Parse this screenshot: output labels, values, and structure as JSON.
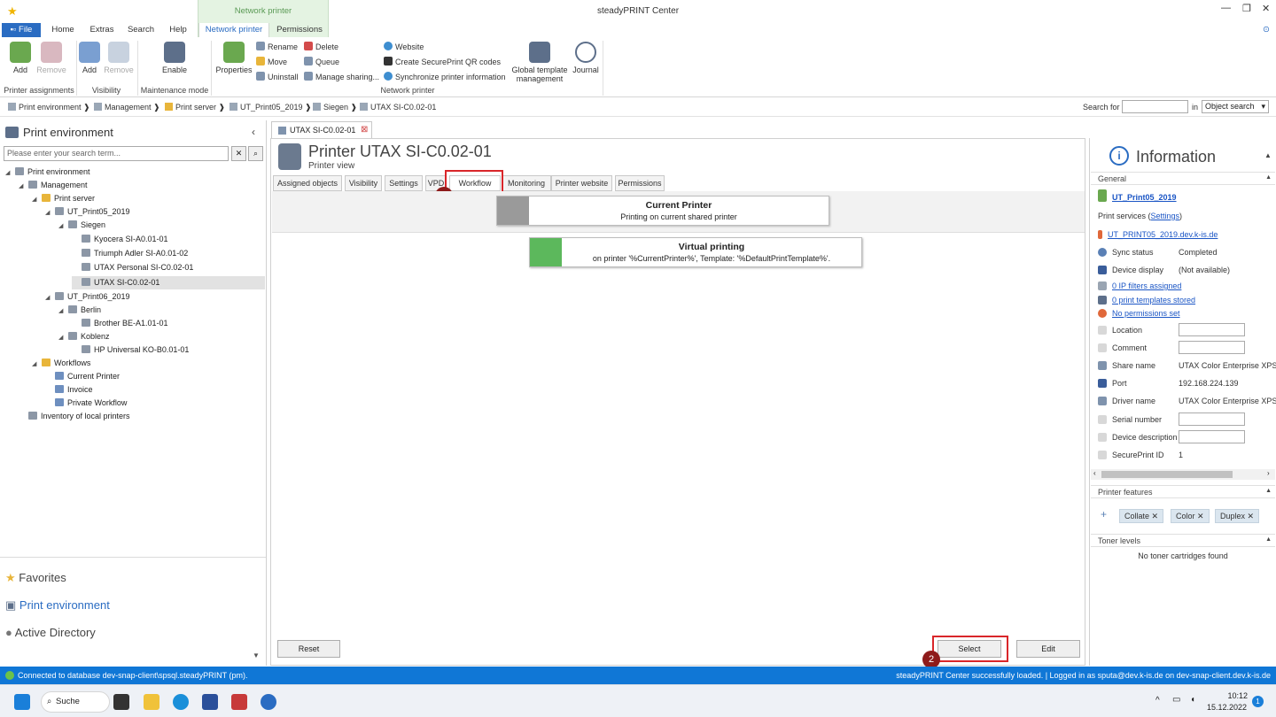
{
  "window": {
    "title": "steadyPRINT Center"
  },
  "ribbon_tabs": {
    "file": "File",
    "home": "Home",
    "extras": "Extras",
    "search": "Search",
    "help": "Help",
    "network_printer": "Network printer",
    "permissions": "Permissions",
    "context_group": "Network printer"
  },
  "ribbon": {
    "add": "Add",
    "remove": "Remove",
    "group_printer_assignments": "Printer assignments",
    "vis_add": "Add",
    "vis_remove": "Remove",
    "group_visibility": "Visibility",
    "enable": "Enable",
    "group_maintenance": "Maintenance mode",
    "properties": "Properties",
    "rename": "Rename",
    "move": "Move",
    "uninstall": "Uninstall",
    "delete": "Delete",
    "queue": "Queue",
    "manage_sharing": "Manage sharing...",
    "website": "Website",
    "qr_codes": "Create SecurePrint QR codes",
    "sync_info": "Synchronize printer information",
    "global_template_1": "Global template",
    "global_template_2": "management",
    "journal": "Journal",
    "group_network_printer": "Network printer"
  },
  "breadcrumb": {
    "items": [
      "Print environment",
      "Management",
      "Print server",
      "UT_Print05_2019",
      "Siegen",
      "UTAX SI-C0.02-01"
    ],
    "search_for": "Search for",
    "in": "in",
    "scope": "Object search"
  },
  "left": {
    "title": "Print environment",
    "search_placeholder": "Please enter your search term...",
    "tree": [
      "Print environment",
      "Management",
      "Print server",
      "UT_Print05_2019",
      "Siegen",
      "Kyocera SI-A0.01-01",
      "Triumph Adler SI-A0.01-02",
      "UTAX Personal SI-C0.02-01",
      "UTAX SI-C0.02-01",
      "UT_Print06_2019",
      "Berlin",
      "Brother BE-A1.01-01",
      "Koblenz",
      "HP Universal KO-B0.01-01",
      "Workflows",
      "Current Printer",
      "Invoice",
      "Private Workflow",
      "Inventory of local printers"
    ],
    "nav": {
      "favorites": "Favorites",
      "print_environment": "Print environment",
      "active_directory": "Active Directory"
    }
  },
  "center": {
    "doc_tab": "UTAX SI-C0.02-01",
    "title": "Printer UTAX SI-C0.02-01",
    "subtitle": "Printer view",
    "tabs": [
      "Assigned objects",
      "Visibility",
      "Settings",
      "VPD",
      "Workflow",
      "Monitoring",
      "Printer website",
      "Permissions"
    ],
    "card1_title": "Current Printer",
    "card1_sub": "Printing on current shared printer",
    "card2_title": "Virtual printing",
    "card2_sub": "on printer '%CurrentPrinter%', Template: '%DefaultPrintTemplate%'.",
    "reset": "Reset",
    "select": "Select",
    "edit": "Edit",
    "badge1": "1",
    "badge2": "2"
  },
  "info": {
    "title": "Information",
    "general": "General",
    "server": "UT_Print05_2019",
    "print_services": "Print services (",
    "settings": "Settings",
    "print_services_close": ")",
    "host": "UT_PRINT05_2019.dev.k-is.de",
    "sync_status_label": "Sync status",
    "sync_status": "Completed",
    "device_display_label": "Device display",
    "device_display": "(Not available)",
    "ip_filters": "0 IP filters assigned",
    "templates": "0 print templates stored",
    "permissions": "No permissions set",
    "location": "Location",
    "comment": "Comment",
    "share_name_label": "Share name",
    "share_name": "UTAX Color Enterprise XPS",
    "port_label": "Port",
    "port": "192.168.224.139",
    "driver_label": "Driver name",
    "driver": "UTAX Color Enterprise XPS",
    "serial": "Serial number",
    "device_desc": "Device description",
    "secureprint_label": "SecurePrint ID",
    "secureprint": "1",
    "features": "Printer features",
    "chips": [
      "Collate",
      "Color",
      "Duplex"
    ],
    "toner": "Toner levels",
    "no_toner": "No toner cartridges found"
  },
  "status": {
    "left": "Connected to database dev-snap-client\\spsql.steadyPRINT (pm).",
    "right": "steadyPRINT Center successfully loaded. | Logged in as sputa@dev.k-is.de on dev-snap-client.dev.k-is.de"
  },
  "taskbar": {
    "search": "Suche",
    "time": "10:12",
    "date": "15.12.2022",
    "notif": "1"
  }
}
